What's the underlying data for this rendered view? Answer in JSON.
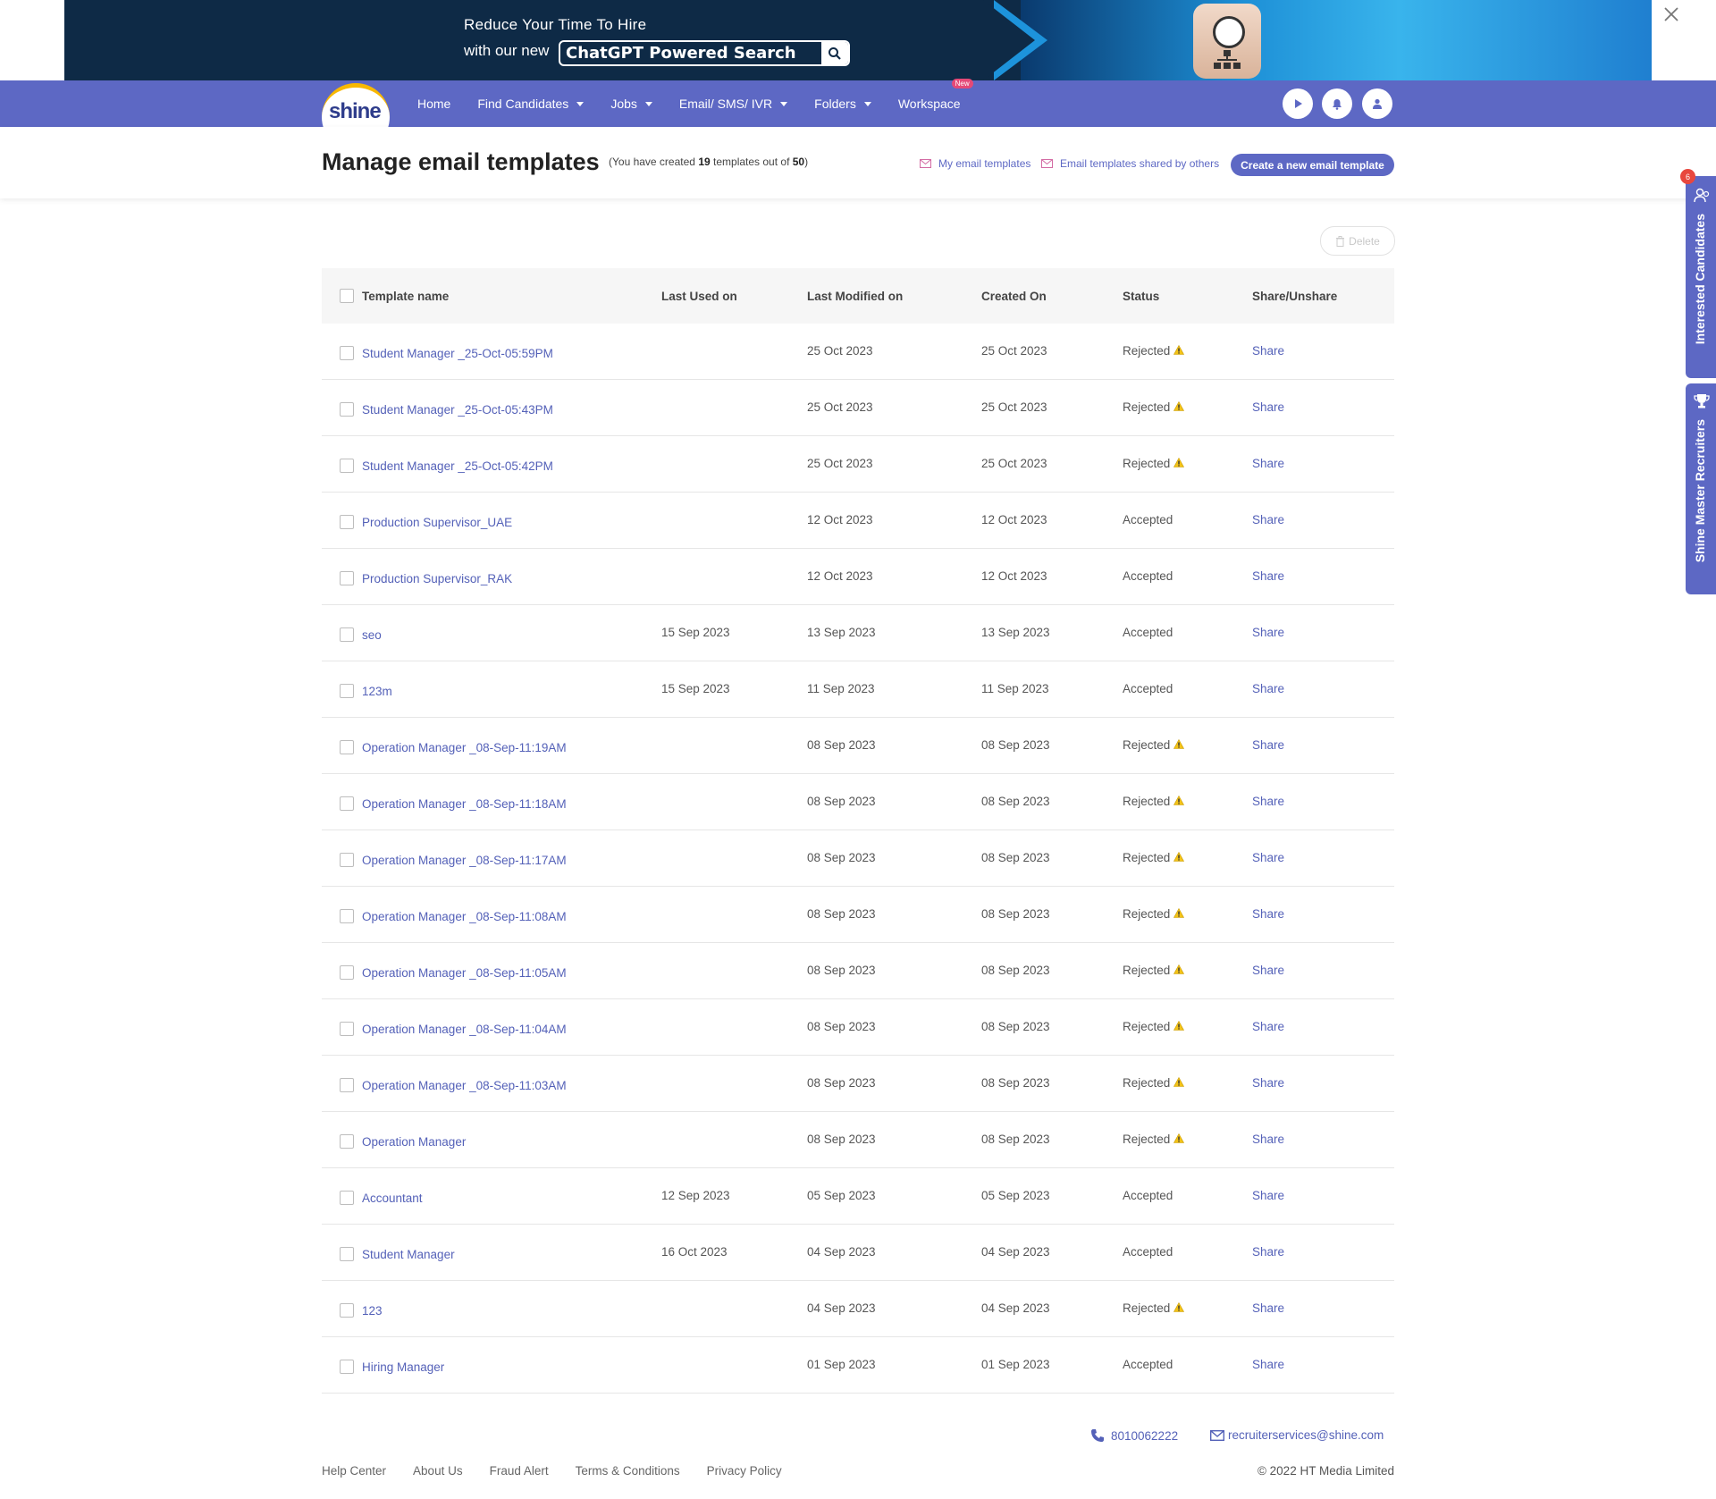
{
  "banner": {
    "line1": "Reduce Your Time To Hire",
    "line2": "with our new",
    "highlight": "ChatGPT Powered Search",
    "close_icon": "close-icon"
  },
  "nav": {
    "logo_text": "shine",
    "items": [
      {
        "label": "Home"
      },
      {
        "label": "Find Candidates"
      },
      {
        "label": "Jobs"
      },
      {
        "label": "Email/ SMS/ IVR"
      },
      {
        "label": "Folders"
      },
      {
        "label": "Workspace",
        "badge": "New"
      }
    ],
    "icons": [
      "play-icon",
      "bell-icon",
      "user-icon"
    ],
    "accent": "#5d68c4"
  },
  "header": {
    "title": "Manage email templates",
    "subtitle_prefix": "(You have created",
    "created_count": "19",
    "subtitle_mid": "templates out of",
    "max_count": "50",
    "subtitle_suffix": ")",
    "link_mine": "My email templates",
    "link_shared": "Email templates shared by others",
    "create_button": "Create a new email template"
  },
  "toolbar": {
    "delete_label": "Delete"
  },
  "table": {
    "columns": [
      "Template name",
      "Last Used on",
      "Last Modified on",
      "Created On",
      "Status",
      "Share/Unshare"
    ],
    "rows": [
      {
        "name": "Student Manager _25-Oct-05:59PM",
        "used": "",
        "modified": "25 Oct 2023",
        "created": "25 Oct 2023",
        "status": "Rejected",
        "warn": true,
        "share": "Share"
      },
      {
        "name": "Student Manager _25-Oct-05:43PM",
        "used": "",
        "modified": "25 Oct 2023",
        "created": "25 Oct 2023",
        "status": "Rejected",
        "warn": true,
        "share": "Share"
      },
      {
        "name": "Student Manager _25-Oct-05:42PM",
        "used": "",
        "modified": "25 Oct 2023",
        "created": "25 Oct 2023",
        "status": "Rejected",
        "warn": true,
        "share": "Share"
      },
      {
        "name": "Production Supervisor_UAE",
        "used": "",
        "modified": "12 Oct 2023",
        "created": "12 Oct 2023",
        "status": "Accepted",
        "warn": false,
        "share": "Share"
      },
      {
        "name": "Production Supervisor_RAK",
        "used": "",
        "modified": "12 Oct 2023",
        "created": "12 Oct 2023",
        "status": "Accepted",
        "warn": false,
        "share": "Share"
      },
      {
        "name": "seo",
        "used": "15 Sep 2023",
        "modified": "13 Sep 2023",
        "created": "13 Sep 2023",
        "status": "Accepted",
        "warn": false,
        "share": "Share"
      },
      {
        "name": "123m",
        "used": "15 Sep 2023",
        "modified": "11 Sep 2023",
        "created": "11 Sep 2023",
        "status": "Accepted",
        "warn": false,
        "share": "Share"
      },
      {
        "name": "Operation Manager _08-Sep-11:19AM",
        "used": "",
        "modified": "08 Sep 2023",
        "created": "08 Sep 2023",
        "status": "Rejected",
        "warn": true,
        "share": "Share"
      },
      {
        "name": "Operation Manager _08-Sep-11:18AM",
        "used": "",
        "modified": "08 Sep 2023",
        "created": "08 Sep 2023",
        "status": "Rejected",
        "warn": true,
        "share": "Share"
      },
      {
        "name": "Operation Manager _08-Sep-11:17AM",
        "used": "",
        "modified": "08 Sep 2023",
        "created": "08 Sep 2023",
        "status": "Rejected",
        "warn": true,
        "share": "Share"
      },
      {
        "name": "Operation Manager _08-Sep-11:08AM",
        "used": "",
        "modified": "08 Sep 2023",
        "created": "08 Sep 2023",
        "status": "Rejected",
        "warn": true,
        "share": "Share"
      },
      {
        "name": "Operation Manager _08-Sep-11:05AM",
        "used": "",
        "modified": "08 Sep 2023",
        "created": "08 Sep 2023",
        "status": "Rejected",
        "warn": true,
        "share": "Share"
      },
      {
        "name": "Operation Manager _08-Sep-11:04AM",
        "used": "",
        "modified": "08 Sep 2023",
        "created": "08 Sep 2023",
        "status": "Rejected",
        "warn": true,
        "share": "Share"
      },
      {
        "name": "Operation Manager _08-Sep-11:03AM",
        "used": "",
        "modified": "08 Sep 2023",
        "created": "08 Sep 2023",
        "status": "Rejected",
        "warn": true,
        "share": "Share"
      },
      {
        "name": "Operation Manager",
        "used": "",
        "modified": "08 Sep 2023",
        "created": "08 Sep 2023",
        "status": "Rejected",
        "warn": true,
        "share": "Share"
      },
      {
        "name": "Accountant",
        "used": "12 Sep 2023",
        "modified": "05 Sep 2023",
        "created": "05 Sep 2023",
        "status": "Accepted",
        "warn": false,
        "share": "Share"
      },
      {
        "name": "Student Manager",
        "used": "16 Oct 2023",
        "modified": "04 Sep 2023",
        "created": "04 Sep 2023",
        "status": "Accepted",
        "warn": false,
        "share": "Share"
      },
      {
        "name": "123",
        "used": "",
        "modified": "04 Sep 2023",
        "created": "04 Sep 2023",
        "status": "Rejected",
        "warn": true,
        "share": "Share"
      },
      {
        "name": "Hiring Manager",
        "used": "",
        "modified": "01 Sep 2023",
        "created": "01 Sep 2023",
        "status": "Accepted",
        "warn": false,
        "share": "Share"
      }
    ]
  },
  "side_tabs": {
    "interested": "Interested Candidates",
    "interested_badge": "6",
    "masters": "Shine Master Recruiters"
  },
  "footer": {
    "phone": "8010062222",
    "email": "recruiterservices@shine.com",
    "links": [
      "Help Center",
      "About Us",
      "Fraud Alert",
      "Terms & Conditions",
      "Privacy Policy"
    ],
    "copyright": "© 2022 HT Media Limited"
  }
}
